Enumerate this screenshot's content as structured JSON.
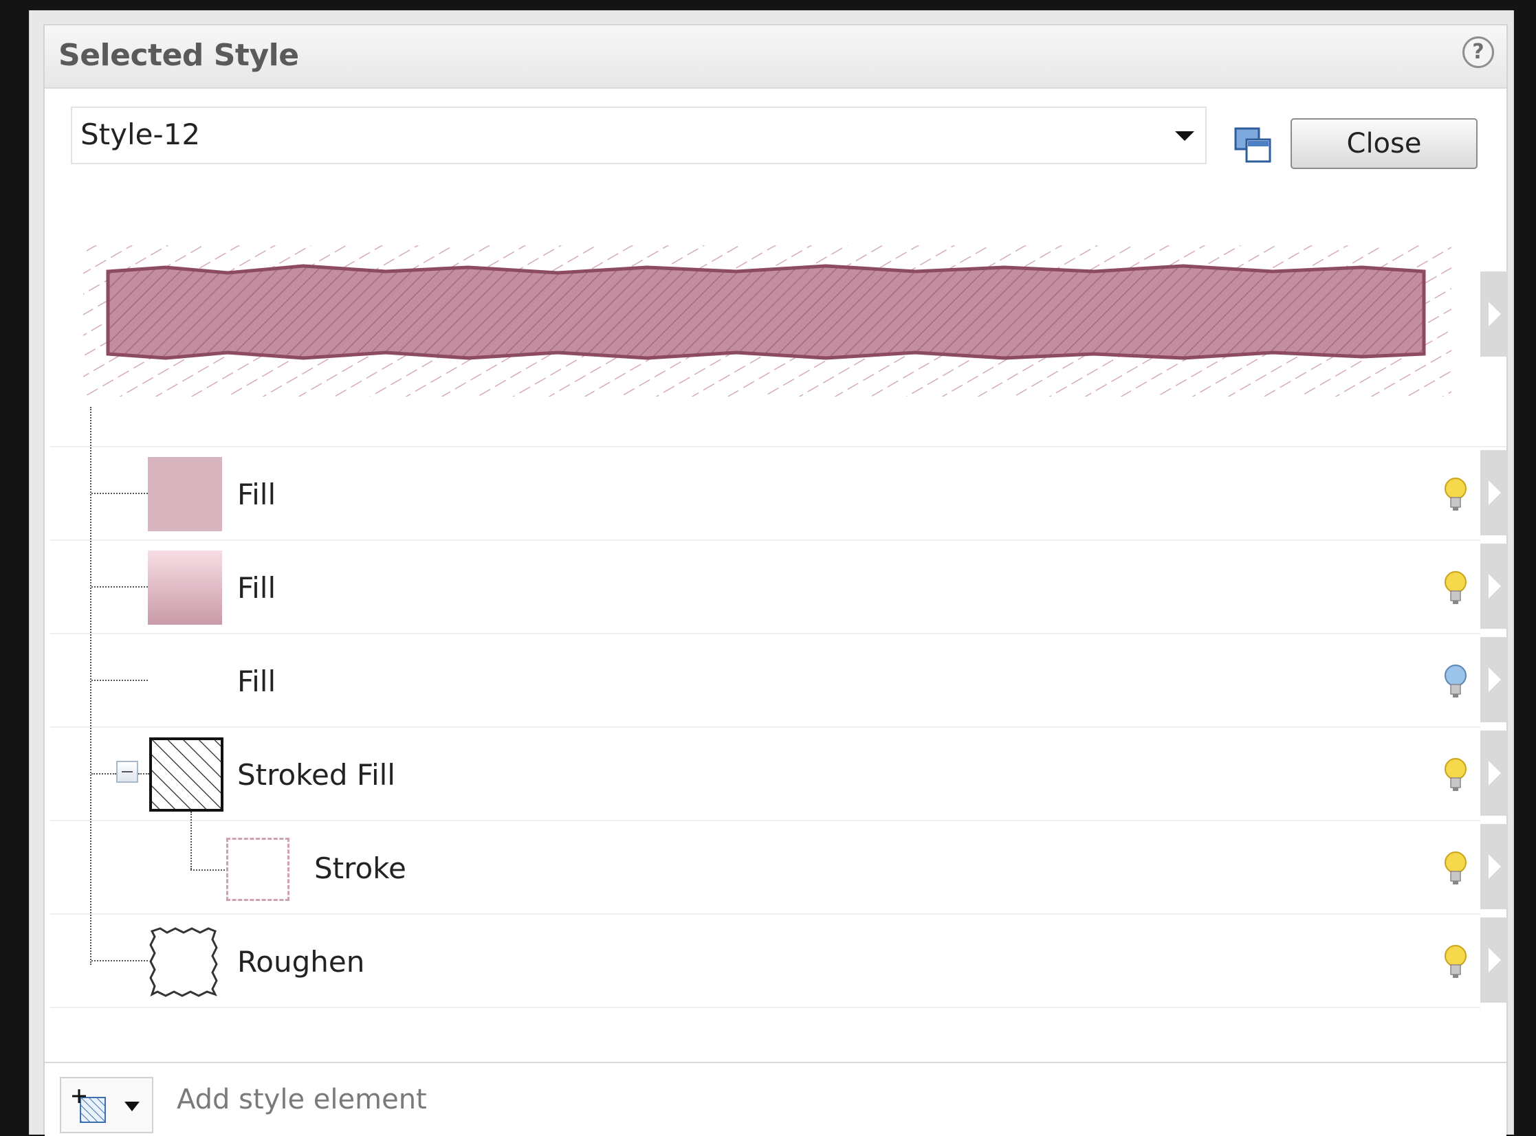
{
  "panel": {
    "title": "Selected Style",
    "help_symbol": "?"
  },
  "style_selector": {
    "value": "Style-12"
  },
  "toolbar": {
    "close_label": "Close"
  },
  "colors": {
    "preview_fill": "#c48fa0",
    "swatch_solid": "#d8b4bf",
    "swatch_gradient_top": "#f7dde4",
    "swatch_gradient_bottom": "#c99aa8",
    "bulb_on": "#f5d94a",
    "bulb_off": "#9cc3ea"
  },
  "elements": [
    {
      "label": "Fill",
      "swatch": "solid",
      "enabled": true
    },
    {
      "label": "Fill",
      "swatch": "gradient",
      "enabled": true
    },
    {
      "label": "Fill",
      "swatch": "none",
      "enabled": false
    },
    {
      "label": "Stroked Fill",
      "swatch": "hatched",
      "enabled": true,
      "expanded": true
    },
    {
      "label": "Stroke",
      "swatch": "dashed-stroke",
      "enabled": true,
      "child": true
    },
    {
      "label": "Roughen",
      "swatch": "roughen",
      "enabled": true
    }
  ],
  "footer": {
    "add_label": "Add style element"
  }
}
